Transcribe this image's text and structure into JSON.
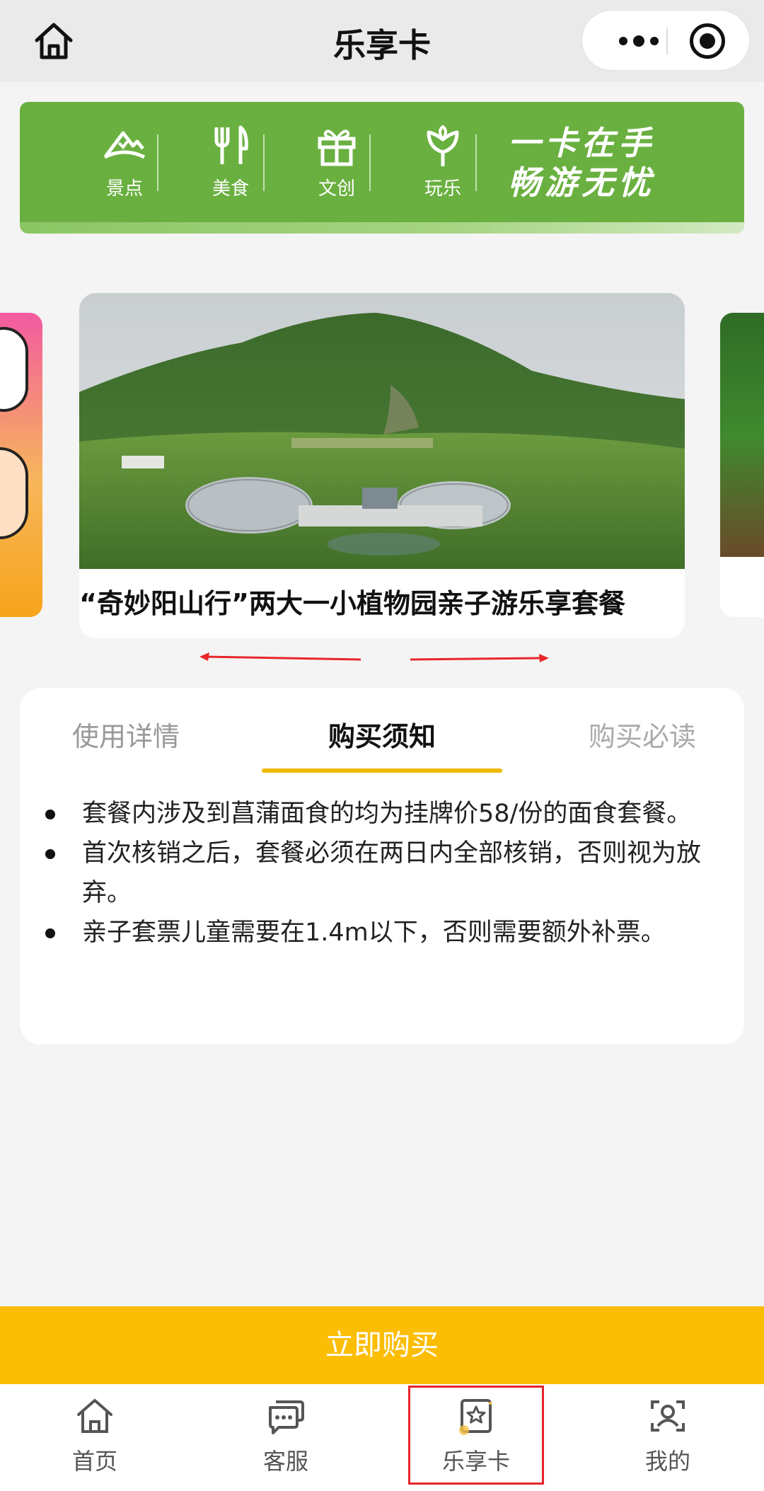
{
  "header": {
    "title": "乐享卡",
    "home_icon": "home-icon",
    "more_icon": "more-dots-icon",
    "close_icon": "target-circle-icon"
  },
  "banner": {
    "categories": [
      {
        "label": "景点",
        "icon": "mountain-icon"
      },
      {
        "label": "美食",
        "icon": "fork-knife-icon"
      },
      {
        "label": "文创",
        "icon": "gift-icon"
      },
      {
        "label": "玩乐",
        "icon": "tulip-icon"
      }
    ],
    "slogan_line1": "一卡在手",
    "slogan_line2": "畅游无忧",
    "color": "#6ab040"
  },
  "carousel": {
    "card_title": "“奇妙阳山行”两大一小植物园亲子游乐享套餐"
  },
  "info": {
    "tabs": [
      "使用详情",
      "购买须知",
      "购买必读"
    ],
    "active_tab": "购买须知",
    "notes": [
      "套餐内涉及到菖蒲面食的均为挂牌价58/份的面食套餐。",
      "首次核销之后，套餐必须在两日内全部核销，否则视为放弃。",
      "亲子套票儿童需要在1.4m以下，否则需要额外补票。"
    ],
    "accent": "#f0b800"
  },
  "buy_button": {
    "label": "立即购买",
    "color": "#fcbd05"
  },
  "tabbar": {
    "items": [
      {
        "label": "首页",
        "icon": "home-icon"
      },
      {
        "label": "客服",
        "icon": "chat-icon"
      },
      {
        "label": "乐享卡",
        "icon": "star-card-icon"
      },
      {
        "label": "我的",
        "icon": "profile-icon"
      }
    ],
    "active": "乐享卡"
  }
}
